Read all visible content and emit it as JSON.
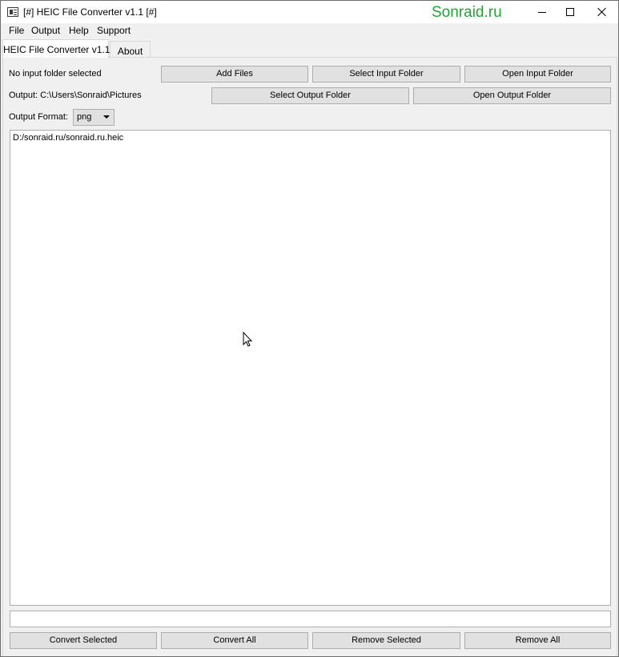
{
  "window": {
    "title": "[#] HEIC File Converter v1.1 [#]",
    "watermark": "Sonraid.ru",
    "watermark_color": "#23a335"
  },
  "menu": {
    "items": [
      "File",
      "Output",
      "Help",
      "Support"
    ]
  },
  "tabs": {
    "active": "HEIC File Converter v1.1",
    "inactive": "About"
  },
  "input": {
    "status": "No input folder selected",
    "add_files": "Add Files",
    "select_input_folder": "Select Input Folder",
    "open_input_folder": "Open Input Folder"
  },
  "output": {
    "path_label": "Output: C:\\Users\\Sonraid\\Pictures",
    "select_output_folder": "Select Output Folder",
    "open_output_folder": "Open Output Folder"
  },
  "format": {
    "label": "Output Format:",
    "selected": "png"
  },
  "file_list": {
    "items": [
      "D:/sonraid.ru/sonraid.ru.heic"
    ]
  },
  "actions": {
    "convert_selected": "Convert Selected",
    "convert_all": "Convert All",
    "remove_selected": "Remove Selected",
    "remove_all": "Remove All"
  },
  "icons": {
    "app": "app-window-icon",
    "minimize": "minimize-icon",
    "maximize": "maximize-icon",
    "close": "close-icon",
    "dropdown": "chevron-down-icon",
    "cursor": "mouse-pointer-icon"
  }
}
